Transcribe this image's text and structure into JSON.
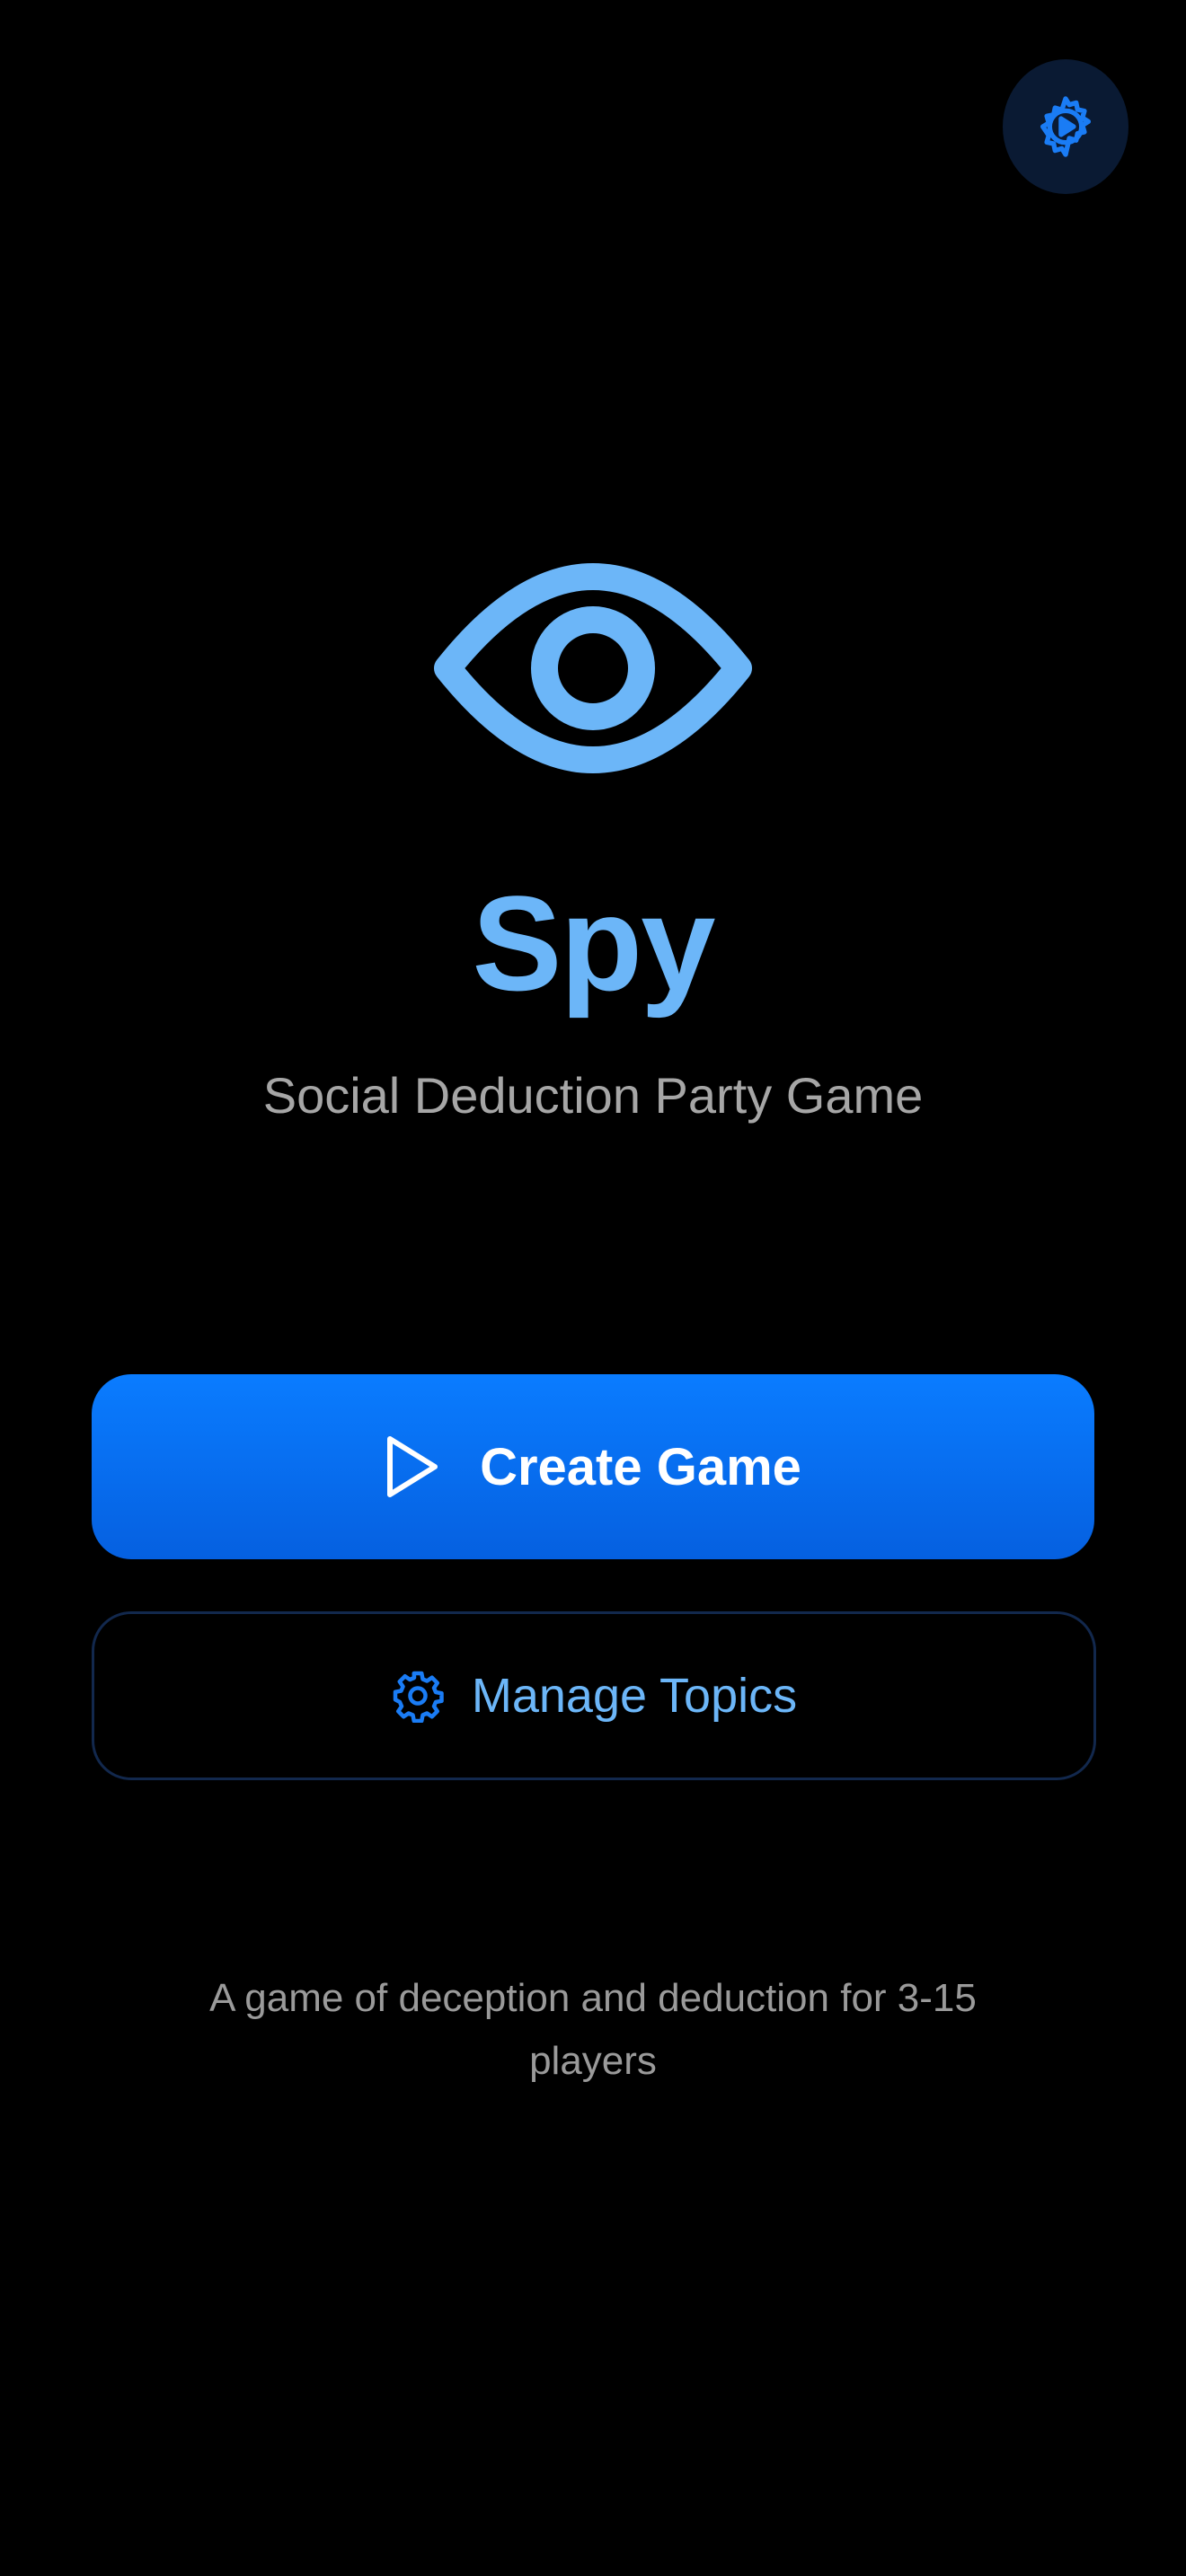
{
  "header": {
    "settings_icon": "gear-play-icon"
  },
  "hero": {
    "icon": "eye-icon",
    "title": "Spy",
    "subtitle": "Social Deduction Party Game"
  },
  "actions": {
    "create": {
      "icon": "play-icon",
      "label": "Create Game"
    },
    "manage": {
      "icon": "gear-icon",
      "label": "Manage Topics"
    }
  },
  "footer": {
    "text": "A game of deception and deduction for 3-15 players"
  },
  "colors": {
    "background": "#000000",
    "accent": "#6cb6f8",
    "primary_button": "#0a7cff",
    "settings_icon": "#1a7cf5",
    "secondary_text": "#a6a6a6"
  }
}
